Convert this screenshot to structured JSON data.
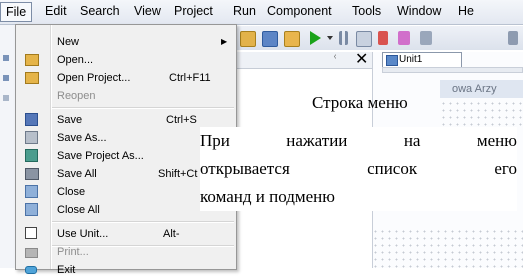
{
  "menubar": {
    "items": [
      "File",
      "Edit",
      "Search",
      "View",
      "Project",
      "Run",
      "Component",
      "Tools",
      "Window",
      "He"
    ]
  },
  "file_menu": {
    "items": [
      {
        "label": "New",
        "shortcut": "",
        "submenu": true,
        "disabled": false,
        "icon": "blank"
      },
      {
        "label": "Open...",
        "shortcut": "",
        "disabled": false,
        "icon": "open-folder-icon"
      },
      {
        "label": "Open Project...",
        "shortcut": "Ctrl+F11",
        "disabled": false,
        "icon": "open-project-icon"
      },
      {
        "label": "Reopen",
        "shortcut": "",
        "disabled": true,
        "icon": "blank"
      },
      {
        "label": "Save",
        "shortcut": "Ctrl+S",
        "disabled": false,
        "icon": "save-icon"
      },
      {
        "label": "Save As...",
        "shortcut": "",
        "disabled": false,
        "icon": "save-as-icon"
      },
      {
        "label": "Save Project As...",
        "shortcut": "",
        "disabled": false,
        "icon": "save-project-icon"
      },
      {
        "label": "Save All",
        "shortcut": "Shift+Ct",
        "disabled": false,
        "icon": "save-all-icon"
      },
      {
        "label": "Close",
        "shortcut": "",
        "disabled": false,
        "icon": "close-file-icon"
      },
      {
        "label": "Close All",
        "shortcut": "",
        "disabled": false,
        "icon": "close-all-icon"
      },
      {
        "label": "Use Unit...",
        "shortcut": "Alt-",
        "disabled": false,
        "icon": "use-unit-icon"
      },
      {
        "label": "Print...",
        "shortcut": "",
        "disabled": true,
        "icon": "print-icon"
      },
      {
        "label": "Exit",
        "shortcut": "",
        "disabled": false,
        "icon": "exit-icon"
      }
    ]
  },
  "editor": {
    "tab_label": "Unit1",
    "form_caption": "owa Arzy"
  },
  "annotations": {
    "menu_bar_label": "Строка меню",
    "description_words_line1": [
      "При",
      "нажатии",
      "на",
      "меню"
    ],
    "description_words_line2": [
      "открывается",
      "список",
      "его"
    ],
    "description_line3": "команд и подменю"
  },
  "colors": {
    "menu_bg": "#f0f0f0",
    "menubar_bg": "#e3e8f1",
    "run_green": "#1aa31a",
    "accent_blue": "#2c5799"
  }
}
